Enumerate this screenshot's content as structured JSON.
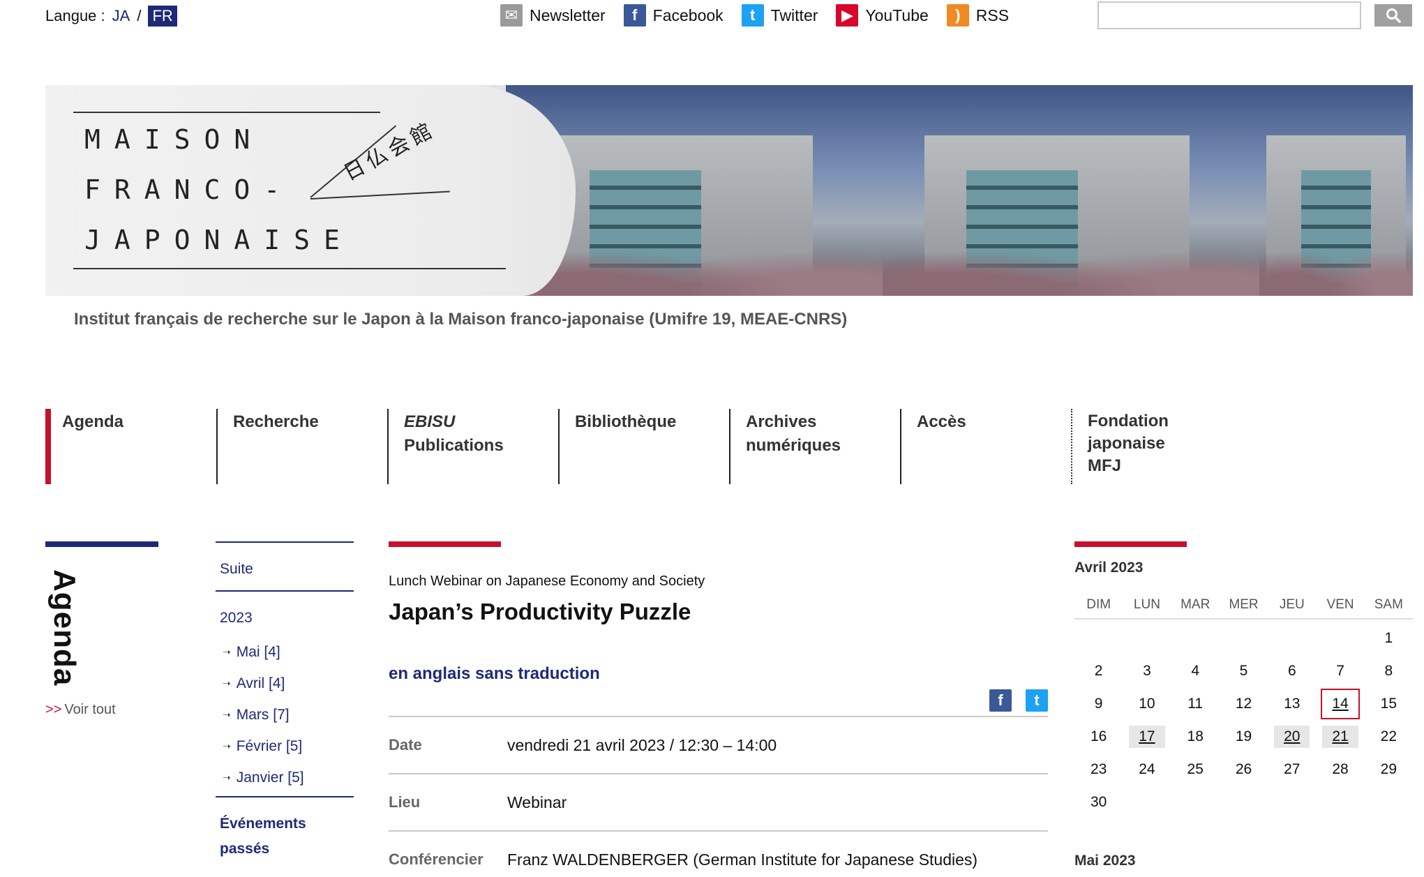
{
  "lang": {
    "label": "Langue :",
    "ja": "JA",
    "sep": "/",
    "fr": "FR"
  },
  "social": [
    {
      "name": "newsletter",
      "label": "Newsletter",
      "glyph": "✉"
    },
    {
      "name": "facebook",
      "label": "Facebook",
      "glyph": "f"
    },
    {
      "name": "twitter",
      "label": "Twitter",
      "glyph": "t"
    },
    {
      "name": "youtube",
      "label": "YouTube",
      "glyph": "▶"
    },
    {
      "name": "rss",
      "label": "RSS",
      "glyph": ")"
    }
  ],
  "search": {
    "value": "",
    "icon": "search-icon"
  },
  "banner": {
    "logo_lines": [
      "MAISON",
      "FRANCO-",
      "JAPONAISE"
    ],
    "logo_jp": "日仏会館"
  },
  "subtitle": "Institut français de recherche sur le Japon à la Maison franco-japonaise (Umifre 19, MEAE-CNRS)",
  "nav": {
    "agenda": "Agenda",
    "recherche": "Recherche",
    "ebisu_italic": "EBISU",
    "ebisu_rest": "Publications",
    "bibliotheque": "Bibliothèque",
    "archives_1": "Archives",
    "archives_2": "numériques",
    "acces": "Accès",
    "fondation_1": "Fondation",
    "fondation_2": "japonaise",
    "fondation_3": "MFJ"
  },
  "side": {
    "agenda": "Agenda",
    "voir_arrow": ">>",
    "voir": "Voir tout"
  },
  "archive": {
    "suite": "Suite",
    "year": "2023",
    "months": [
      "Mai [4]",
      "Avril [4]",
      "Mars [7]",
      "Février [5]",
      "Janvier [5]"
    ],
    "past_1": "Événements",
    "past_2": "passés"
  },
  "event": {
    "series": "Lunch Webinar on Japanese Economy and Society",
    "title": "Japan’s Productivity Puzzle",
    "lang_note": "en anglais sans traduction",
    "rows": [
      {
        "label": "Date",
        "value": "vendredi 21 avril 2023 / 12:30 – 14:00"
      },
      {
        "label": "Lieu",
        "value": "Webinar"
      },
      {
        "label": "Conférencier",
        "value": "Franz WALDENBERGER (German Institute for Japanese Studies)"
      }
    ]
  },
  "calendar": {
    "month": "Avril 2023",
    "dows": [
      "DIM",
      "LUN",
      "MAR",
      "MER",
      "JEU",
      "VEN",
      "SAM"
    ],
    "days": [
      "",
      "",
      "",
      "",
      "",
      "",
      "1",
      "2",
      "3",
      "4",
      "5",
      "6",
      "7",
      "8",
      "9",
      "10",
      "11",
      "12",
      "13",
      "14",
      "15",
      "16",
      "17",
      "18",
      "19",
      "20",
      "21",
      "22",
      "23",
      "24",
      "25",
      "26",
      "27",
      "28",
      "29",
      "30"
    ],
    "event_days": [
      "17",
      "20",
      "21"
    ],
    "today": "14",
    "next_month": "Mai 2023"
  },
  "colors": {
    "navy": "#1e2a78",
    "red": "#c8102e"
  }
}
